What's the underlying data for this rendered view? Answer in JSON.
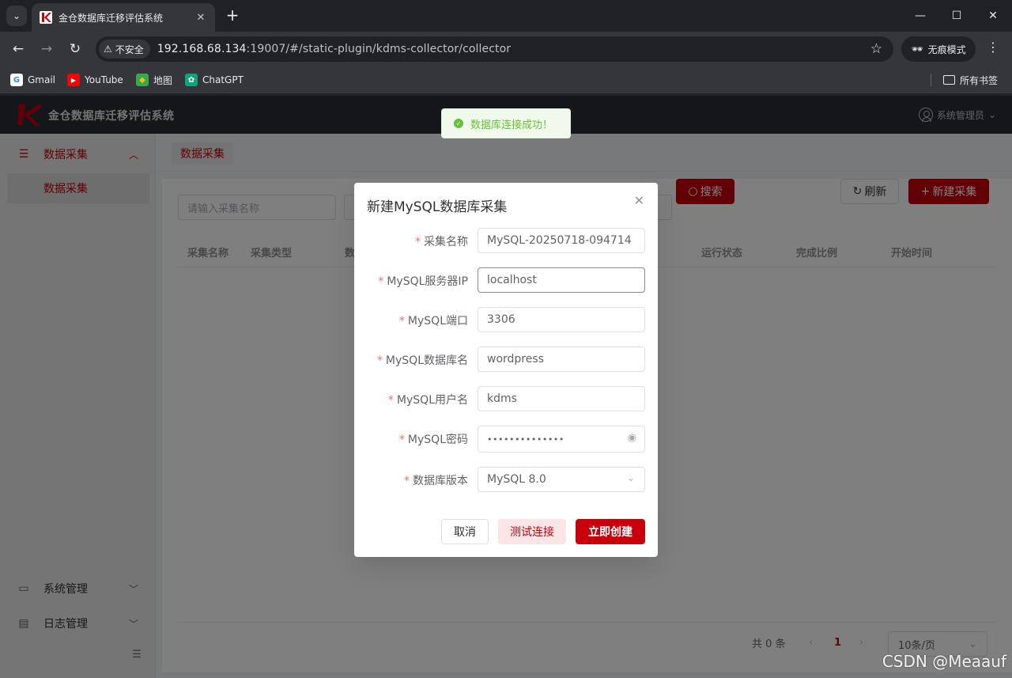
{
  "browser": {
    "tab_title": "金仓数据库迁移评估系统",
    "insecure_label": "不安全",
    "url_host": "192.168.68.134",
    "url_rest": ":19007/#/static-plugin/kdms-collector/collector",
    "incognito_label": "无痕模式",
    "bookmarks": [
      {
        "label": "Gmail",
        "icon": "google-icon"
      },
      {
        "label": "YouTube",
        "icon": "youtube-icon"
      },
      {
        "label": "地图",
        "icon": "maps-icon"
      },
      {
        "label": "ChatGPT",
        "icon": "chatgpt-icon"
      }
    ],
    "all_bookmarks_label": "所有书签"
  },
  "app": {
    "title": "金仓数据库迁移评估系统",
    "user_label": "系统管理员",
    "brand_color": "#c7000b"
  },
  "sidebar": {
    "group_data": "数据采集",
    "item_data": "数据采集",
    "group_system": "系统管理",
    "group_log": "日志管理"
  },
  "breadcrumb": {
    "tag": "数据采集"
  },
  "list": {
    "search_placeholder": "请输入采集名称",
    "search_button": "搜索",
    "refresh_button": "刷新",
    "create_button": "新建采集",
    "columns": [
      "采集名称",
      "采集类型",
      "数",
      "运行状态",
      "完成比例",
      "开始时间"
    ],
    "total_text": "共 0 条",
    "current_page": "1",
    "page_size": "10条/页"
  },
  "toast": {
    "message": "数据库连接成功！"
  },
  "dialog": {
    "title": "新建MySQL数据库采集",
    "fields": [
      {
        "label": "采集名称",
        "value": "MySQL-20250718-094714"
      },
      {
        "label": "MySQL服务器IP",
        "value": "localhost"
      },
      {
        "label": "MySQL端口",
        "value": "3306"
      },
      {
        "label": "MySQL数据库名",
        "value": "wordpress"
      },
      {
        "label": "MySQL用户名",
        "value": "kdms"
      },
      {
        "label": "MySQL密码",
        "value": "••••••••••••••"
      },
      {
        "label": "数据库版本",
        "value": "MySQL 8.0"
      }
    ],
    "cancel_button": "取消",
    "test_button": "测试连接",
    "create_button": "立即创建"
  },
  "watermark": "CSDN @Meaauf"
}
